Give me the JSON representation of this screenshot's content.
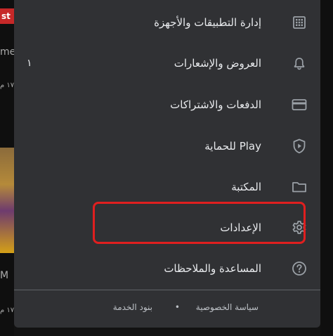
{
  "background": {
    "badge_text": "st",
    "fragment_1": "me",
    "fragment_2": "١٧ م",
    "fragment_3": "M",
    "fragment_4": "١٧ م"
  },
  "menu": {
    "items": [
      {
        "label": "إدارة التطبيقات والأجهزة",
        "icon": "apps-grid-icon"
      },
      {
        "label": "العروض والإشعارات",
        "icon": "bell-icon",
        "count": "١"
      },
      {
        "label": "الدفعات والاشتراكات",
        "icon": "credit-card-icon"
      },
      {
        "label": "Play للحماية",
        "icon": "play-protect-shield-icon"
      },
      {
        "label": "المكتبة",
        "icon": "folder-icon"
      },
      {
        "label": "الإعدادات",
        "icon": "gear-icon"
      },
      {
        "label": "المساعدة والملاحظات",
        "icon": "help-circle-icon"
      }
    ],
    "footer": {
      "privacy": "سياسة الخصوصية",
      "separator": "•",
      "terms": "بنود الخدمة"
    }
  },
  "colors": {
    "menu_bg": "#303134",
    "highlight": "#e01f1f",
    "icon": "#9aa0a6"
  }
}
